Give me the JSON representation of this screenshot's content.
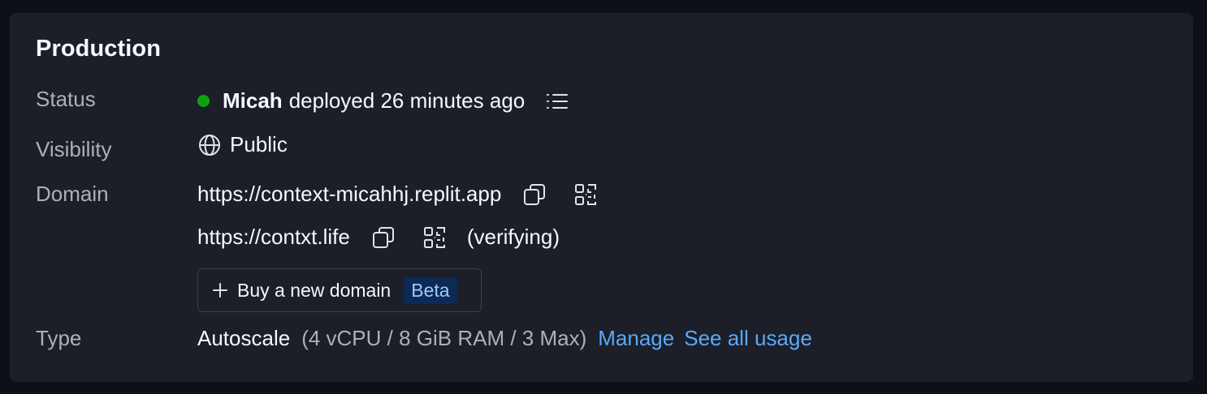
{
  "section": {
    "title": "Production"
  },
  "labels": {
    "status": "Status",
    "visibility": "Visibility",
    "domain": "Domain",
    "type": "Type"
  },
  "status": {
    "user": "Micah",
    "text": "deployed 26 minutes ago",
    "dot_color": "#0ea30e",
    "log_icon": "list-icon"
  },
  "visibility": {
    "icon": "globe-icon",
    "value": "Public"
  },
  "domains": [
    {
      "url": "https://context-micahhj.replit.app",
      "note": ""
    },
    {
      "url": "https://contxt.life",
      "note": "(verifying)"
    }
  ],
  "buy_domain": {
    "label": "Buy a new domain",
    "badge": "Beta"
  },
  "type": {
    "value": "Autoscale",
    "specs": "(4 vCPU / 8 GiB RAM / 3 Max)",
    "manage_link": "Manage",
    "usage_link": "See all usage"
  },
  "colors": {
    "background": "#0e1017",
    "card": "#1c1f27",
    "link": "#5aa8ff",
    "status_green": "#0ea30e",
    "badge_bg": "#0c2a55"
  }
}
